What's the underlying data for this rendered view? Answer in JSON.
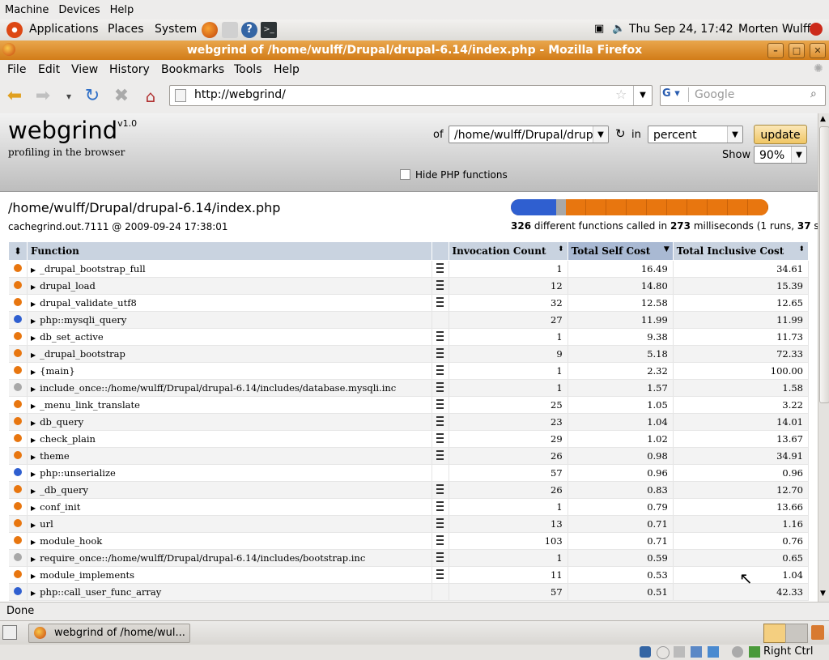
{
  "vbox_menu": [
    "Machine",
    "Devices",
    "Help"
  ],
  "gnome_panel": {
    "menus": [
      "Applications",
      "Places",
      "System"
    ],
    "clock": "Thu Sep 24, 17:42",
    "user": "Morten Wulff"
  },
  "window_title": "webgrind of /home/wulff/Drupal/drupal-6.14/index.php - Mozilla Firefox",
  "firefox_menu": [
    "File",
    "Edit",
    "View",
    "History",
    "Bookmarks",
    "Tools",
    "Help"
  ],
  "url": "http://webgrind/",
  "search_placeholder": "Google",
  "webgrind": {
    "logo": "webgrind",
    "version": "v1.0",
    "tagline": "profiling in the browser",
    "of_label": "of",
    "file_select": "/home/wulff/Drupal/drupal-6.14/index.php",
    "in_label": "in",
    "unit_select": "percent",
    "update_label": "update",
    "show_label": "Show",
    "show_select": "90%",
    "hide_php_label": "Hide PHP functions",
    "hide_php_checked": false,
    "file_path": "/home/wulff/Drupal/drupal-6.14/index.php",
    "cachegrind": "cachegrind.out.7111 @ 2009-09-24 17:38:01",
    "summary": {
      "functions": "326",
      "text1": " different functions called in ",
      "ms": "273",
      "text2": " milliseconds (1 runs, ",
      "shown": "37",
      "text3": " shown)"
    },
    "columns": [
      "Function",
      "Invocation Count",
      "Total Self Cost",
      "Total Inclusive Cost"
    ],
    "colors": {
      "user": "#e8760f",
      "internal": "#2f5fd0",
      "include": "#a8a8a8"
    },
    "rows": [
      {
        "kind": "user",
        "name": "_drupal_bootstrap_full",
        "doc": true,
        "count": "1",
        "self": "16.49",
        "incl": "34.61"
      },
      {
        "kind": "user",
        "name": "drupal_load",
        "doc": true,
        "count": "12",
        "self": "14.80",
        "incl": "15.39"
      },
      {
        "kind": "user",
        "name": "drupal_validate_utf8",
        "doc": true,
        "count": "32",
        "self": "12.58",
        "incl": "12.65"
      },
      {
        "kind": "internal",
        "name": "php::mysqli_query",
        "doc": false,
        "count": "27",
        "self": "11.99",
        "incl": "11.99"
      },
      {
        "kind": "user",
        "name": "db_set_active",
        "doc": true,
        "count": "1",
        "self": "9.38",
        "incl": "11.73"
      },
      {
        "kind": "user",
        "name": "_drupal_bootstrap",
        "doc": true,
        "count": "9",
        "self": "5.18",
        "incl": "72.33"
      },
      {
        "kind": "user",
        "name": "{main}",
        "doc": true,
        "count": "1",
        "self": "2.32",
        "incl": "100.00"
      },
      {
        "kind": "include",
        "name": "include_once::/home/wulff/Drupal/drupal-6.14/includes/database.mysqli.inc",
        "doc": true,
        "count": "1",
        "self": "1.57",
        "incl": "1.58"
      },
      {
        "kind": "user",
        "name": "_menu_link_translate",
        "doc": true,
        "count": "25",
        "self": "1.05",
        "incl": "3.22"
      },
      {
        "kind": "user",
        "name": "db_query",
        "doc": true,
        "count": "23",
        "self": "1.04",
        "incl": "14.01"
      },
      {
        "kind": "user",
        "name": "check_plain",
        "doc": true,
        "count": "29",
        "self": "1.02",
        "incl": "13.67"
      },
      {
        "kind": "user",
        "name": "theme",
        "doc": true,
        "count": "26",
        "self": "0.98",
        "incl": "34.91"
      },
      {
        "kind": "internal",
        "name": "php::unserialize",
        "doc": false,
        "count": "57",
        "self": "0.96",
        "incl": "0.96"
      },
      {
        "kind": "user",
        "name": "_db_query",
        "doc": true,
        "count": "26",
        "self": "0.83",
        "incl": "12.70"
      },
      {
        "kind": "user",
        "name": "conf_init",
        "doc": true,
        "count": "1",
        "self": "0.79",
        "incl": "13.66"
      },
      {
        "kind": "user",
        "name": "url",
        "doc": true,
        "count": "13",
        "self": "0.71",
        "incl": "1.16"
      },
      {
        "kind": "user",
        "name": "module_hook",
        "doc": true,
        "count": "103",
        "self": "0.71",
        "incl": "0.76"
      },
      {
        "kind": "include",
        "name": "require_once::/home/wulff/Drupal/drupal-6.14/includes/bootstrap.inc",
        "doc": true,
        "count": "1",
        "self": "0.59",
        "incl": "0.65"
      },
      {
        "kind": "user",
        "name": "module_implements",
        "doc": true,
        "count": "11",
        "self": "0.53",
        "incl": "1.04"
      },
      {
        "kind": "internal",
        "name": "php::call_user_func_array",
        "doc": false,
        "count": "57",
        "self": "0.51",
        "incl": "42.33"
      }
    ]
  },
  "status": "Done",
  "taskbar_item": "webgrind of /home/wul...",
  "vbox_host_key": "Right Ctrl"
}
